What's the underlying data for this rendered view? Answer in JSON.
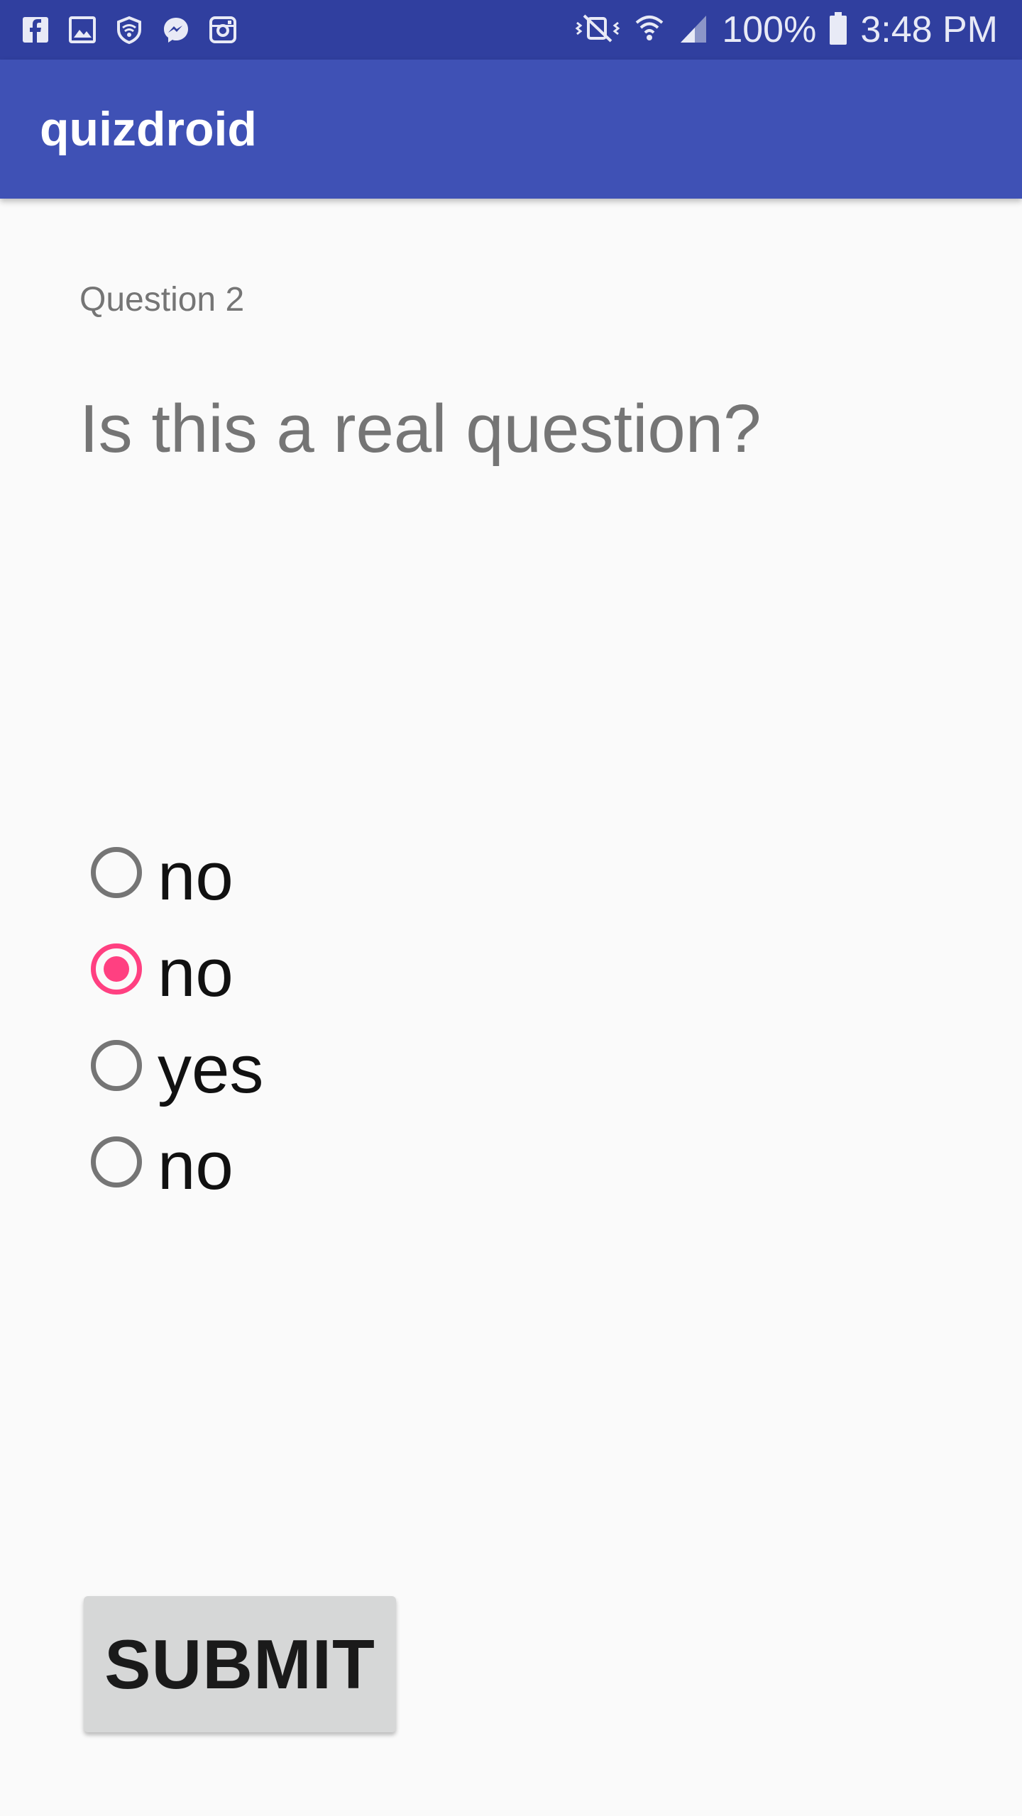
{
  "status_bar": {
    "left_icons": [
      "facebook-icon",
      "gallery-icon",
      "vpn-shield-icon",
      "messenger-icon",
      "instagram-icon"
    ],
    "right_icons": [
      "vibrate-icon",
      "wifi-icon",
      "signal-icon",
      "battery-icon"
    ],
    "battery_text": "100%",
    "time": "3:48 PM",
    "color": "#303f9f"
  },
  "app_bar": {
    "title": "quizdroid",
    "color": "#3f51b5"
  },
  "question": {
    "label": "Question 2",
    "text": "Is this a real question?"
  },
  "options": [
    {
      "label": "no",
      "checked": false
    },
    {
      "label": "no",
      "checked": true
    },
    {
      "label": "yes",
      "checked": false
    },
    {
      "label": "no",
      "checked": false
    }
  ],
  "submit": {
    "label": "SUBMIT"
  },
  "colors": {
    "accent": "#ff4081",
    "background": "#fafafa",
    "button": "#d6d7d7"
  }
}
